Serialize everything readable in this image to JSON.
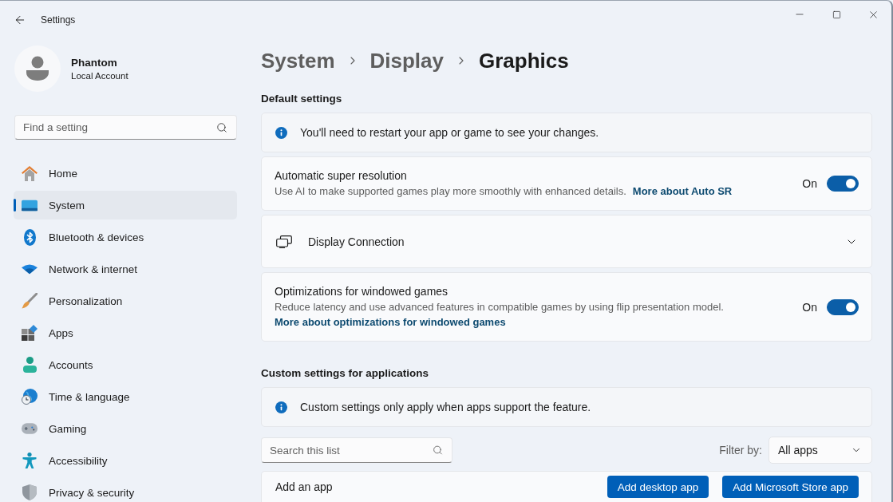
{
  "window": {
    "title": "Settings"
  },
  "account": {
    "name": "Phantom",
    "type": "Local Account"
  },
  "search": {
    "placeholder": "Find a setting"
  },
  "sidebar": {
    "items": [
      {
        "label": "Home",
        "selected": false
      },
      {
        "label": "System",
        "selected": true
      },
      {
        "label": "Bluetooth & devices",
        "selected": false
      },
      {
        "label": "Network & internet",
        "selected": false
      },
      {
        "label": "Personalization",
        "selected": false
      },
      {
        "label": "Apps",
        "selected": false
      },
      {
        "label": "Accounts",
        "selected": false
      },
      {
        "label": "Time & language",
        "selected": false
      },
      {
        "label": "Gaming",
        "selected": false
      },
      {
        "label": "Accessibility",
        "selected": false
      },
      {
        "label": "Privacy & security",
        "selected": false
      }
    ]
  },
  "breadcrumb": [
    {
      "label": "System"
    },
    {
      "label": "Display"
    },
    {
      "label": "Graphics"
    }
  ],
  "sections": [
    {
      "heading": "Default settings",
      "items": [
        {
          "kind": "info",
          "text": "You'll need to restart your app or game to see your changes."
        },
        {
          "kind": "toggle",
          "title": "Automatic super resolution",
          "description": "Use AI to make supported games play more smoothly with enhanced details.",
          "link": "More about Auto SR",
          "state_label": "On",
          "on": true
        },
        {
          "kind": "expander",
          "title": "Display Connection",
          "expanded": false
        },
        {
          "kind": "toggle",
          "title": "Optimizations for windowed games",
          "description": "Reduce latency and use advanced features in compatible games by using flip presentation model.",
          "link": "More about optimizations for windowed games",
          "state_label": "On",
          "on": true
        }
      ]
    },
    {
      "heading": "Custom settings for applications",
      "items": [
        {
          "kind": "info",
          "text": "Custom settings only apply when apps support the feature."
        },
        {
          "kind": "list_controls",
          "search_placeholder": "Search this list",
          "filter_label": "Filter by:",
          "filter_value": "All apps"
        },
        {
          "kind": "add_app",
          "label": "Add an app",
          "buttons": [
            "Add desktop app",
            "Add Microsoft Store app"
          ]
        }
      ]
    }
  ]
}
